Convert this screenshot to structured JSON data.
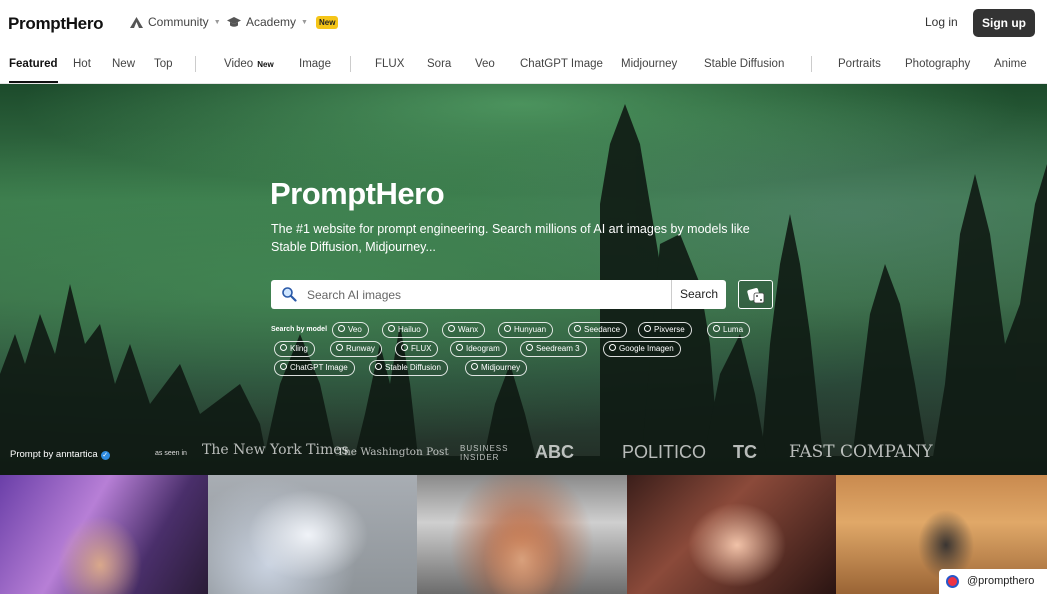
{
  "header": {
    "logo": "PromptHero",
    "community_label": "Community",
    "academy_label": "Academy",
    "academy_badge": "New",
    "login_label": "Log in",
    "signup_label": "Sign up"
  },
  "tabs": {
    "featured": "Featured",
    "hot": "Hot",
    "new": "New",
    "top": "Top",
    "video": "Video",
    "video_badge": "New",
    "image": "Image",
    "flux": "FLUX",
    "sora": "Sora",
    "veo": "Veo",
    "chatgpt_image": "ChatGPT Image",
    "midjourney": "Midjourney",
    "stable_diffusion": "Stable Diffusion",
    "portraits": "Portraits",
    "photography": "Photography",
    "anime": "Anime"
  },
  "hero": {
    "title": "PromptHero",
    "subtitle": "The #1 website for prompt engineering. Search millions of AI art images by models like Stable Diffusion, Midjourney...",
    "search_placeholder": "Search AI images",
    "search_button": "Search",
    "models_label": "Search by model",
    "models": [
      "Veo",
      "Hailuo",
      "Wanx",
      "Hunyuan",
      "Seedance",
      "Pixverse",
      "Luma",
      "Kling",
      "Runway",
      "FLUX",
      "Ideogram",
      "Seedream 3",
      "Google Imagen",
      "ChatGPT Image",
      "Stable Diffusion",
      "Midjourney"
    ],
    "prompt_by": "Prompt by anntartica",
    "as_seen_in": "as seen in",
    "press": [
      "The New York Times",
      "The Washington Post",
      "BUSINESS INSIDER",
      "ABC",
      "POLITICO",
      "TC",
      "FAST COMPANY"
    ]
  },
  "gallery": {
    "handle": "@prompthero"
  },
  "colors": {
    "accent_badge": "#f5c518",
    "signup_bg": "#333333",
    "verified": "#2e8be0"
  }
}
